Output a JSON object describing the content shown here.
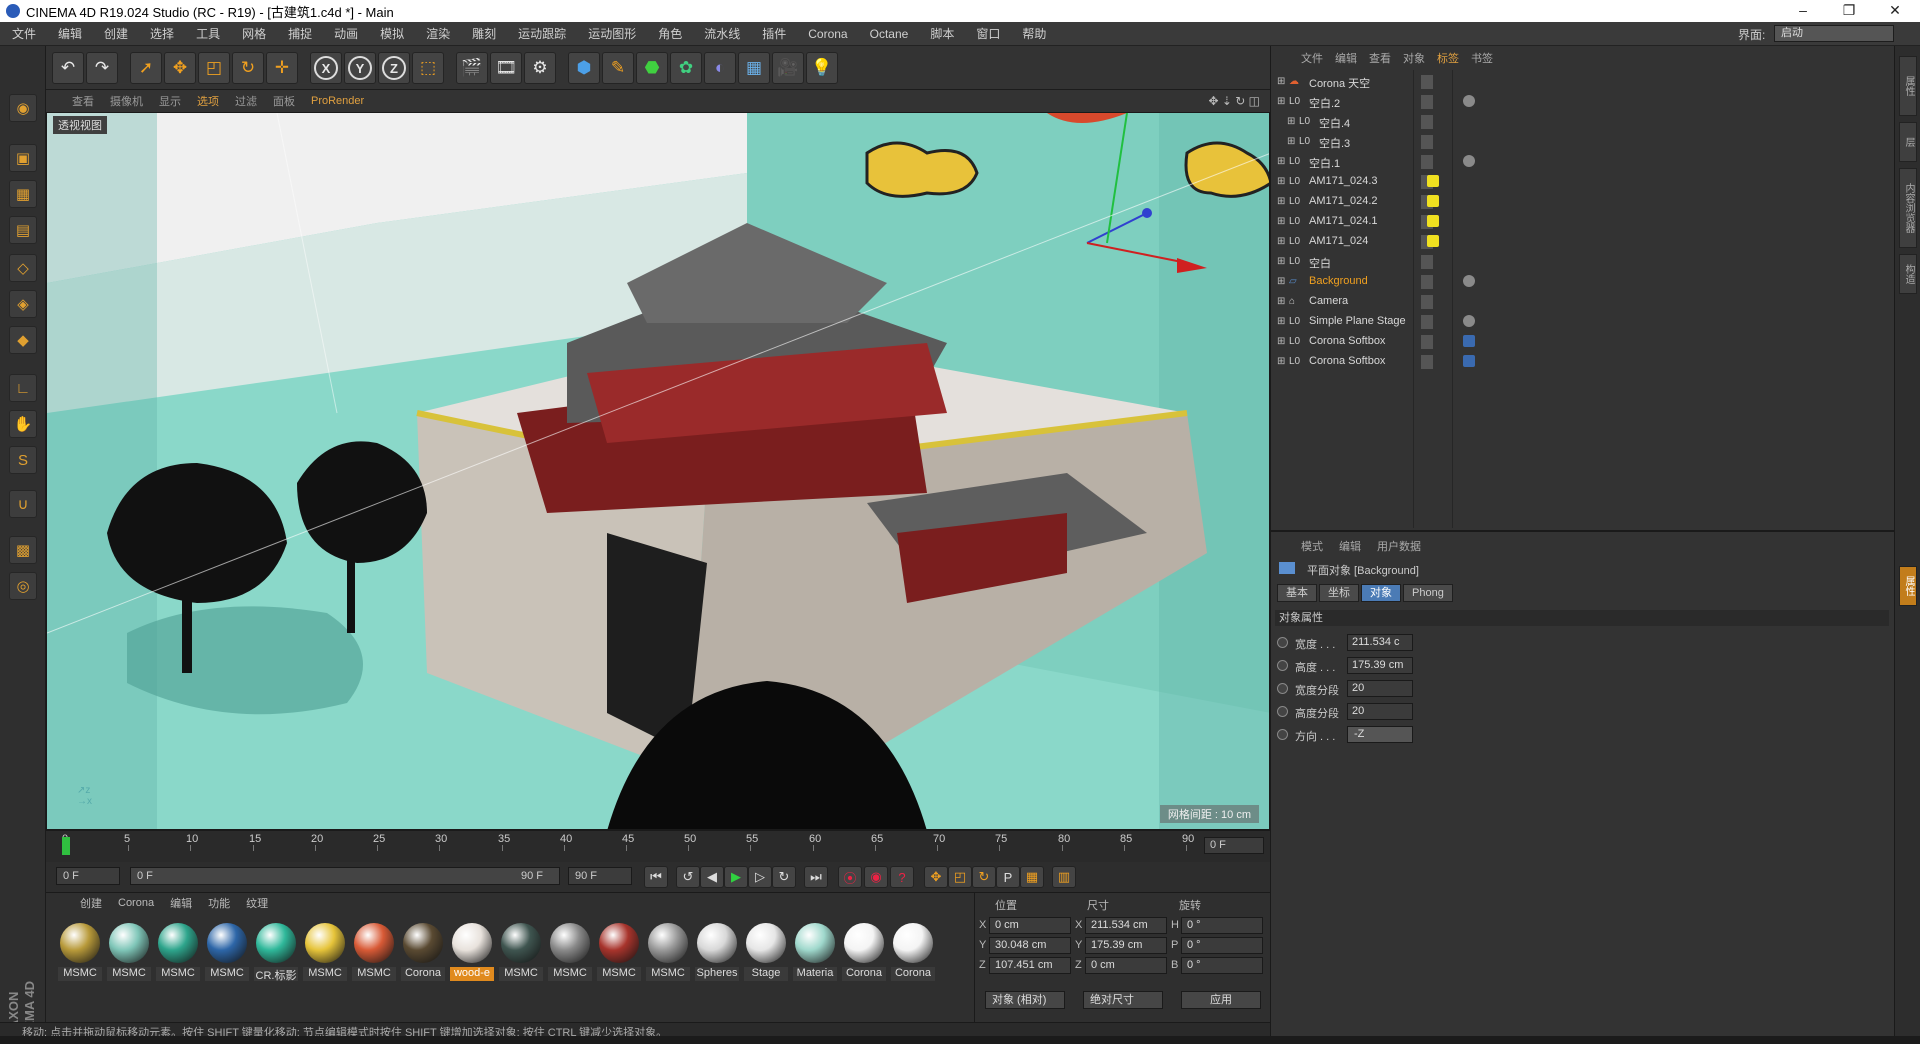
{
  "window": {
    "title": "CINEMA 4D R19.024 Studio (RC - R19) - [古建筑1.c4d *] - Main",
    "controls": [
      "–",
      "❐",
      "✕"
    ]
  },
  "menubar": {
    "items": [
      "文件",
      "编辑",
      "创建",
      "选择",
      "工具",
      "网格",
      "捕捉",
      "动画",
      "模拟",
      "渲染",
      "雕刻",
      "运动跟踪",
      "运动图形",
      "角色",
      "流水线",
      "插件",
      "Corona",
      "Octane",
      "脚本",
      "窗口",
      "帮助"
    ],
    "layout_label": "界面:",
    "layout_value": "启动"
  },
  "viewport": {
    "menu": [
      "查看",
      "摄像机",
      "显示",
      "选项",
      "过滤",
      "面板"
    ],
    "active_menu": "选项",
    "renderer": "ProRender",
    "view_label": "透视视图",
    "grid_spacing": "网格间距 : 10 cm"
  },
  "timeline": {
    "ticks": [
      "0",
      "5",
      "10",
      "15",
      "20",
      "25",
      "30",
      "35",
      "40",
      "45",
      "50",
      "55",
      "60",
      "65",
      "70",
      "75",
      "80",
      "85",
      "90"
    ],
    "current_frame": "0 F",
    "start": "0 F",
    "range_start": "0 F",
    "range_end": "90 F",
    "end": "90 F"
  },
  "materials": {
    "menu": [
      "创建",
      "Corona",
      "编辑",
      "功能",
      "纹理"
    ],
    "items": [
      {
        "name": "MSMC",
        "color": "#b89a3a"
      },
      {
        "name": "MSMC",
        "color": "#7fc6b8"
      },
      {
        "name": "MSMC",
        "color": "#2ea58c"
      },
      {
        "name": "MSMC",
        "color": "#2d66a8"
      },
      {
        "name": "CR.标影",
        "color": "#2fb89a"
      },
      {
        "name": "MSMC",
        "color": "#e6c43a"
      },
      {
        "name": "MSMC",
        "color": "#d85a36"
      },
      {
        "name": "Corona",
        "color": "#5a4a32"
      },
      {
        "name": "wood-e",
        "color": "#e8e2dc"
      },
      {
        "name": "MSMC",
        "color": "#3f5550"
      },
      {
        "name": "MSMC",
        "color": "#8a8a8a"
      },
      {
        "name": "MSMC",
        "color": "#a8342c"
      },
      {
        "name": "MSMC",
        "color": "#9a9a9a"
      },
      {
        "name": "Spheres",
        "color": "#d8d8d8"
      },
      {
        "name": "Stage",
        "color": "#e6e6e6"
      },
      {
        "name": "Materia",
        "color": "#9fd8cc"
      },
      {
        "name": "Corona",
        "color": "#f4f4f4"
      },
      {
        "name": "Corona",
        "color": "#f4f4f4"
      }
    ],
    "selected_index": 8
  },
  "coordinates": {
    "headers": [
      "位置",
      "尺寸",
      "旋转"
    ],
    "position": {
      "X": "0 cm",
      "Y": "30.048 cm",
      "Z": "107.451 cm"
    },
    "size": {
      "X": "211.534 cm",
      "Y": "175.39 cm",
      "Z": "0 cm"
    },
    "rotation": {
      "H": "0 °",
      "P": "0 °",
      "B": "0 °"
    },
    "mode_object": "对象 (相对)",
    "mode_size": "绝对尺寸",
    "apply": "应用"
  },
  "status": "移动: 点击并拖动鼠标移动元素。按住 SHIFT 键量化移动; 节点编辑模式时按住 SHIFT 键增加选择对象; 按住 CTRL 键减少选择对象。",
  "object_manager": {
    "menu": [
      "文件",
      "编辑",
      "查看",
      "对象",
      "标签",
      "书签"
    ],
    "active_menu": "标签",
    "objects": [
      {
        "name": "Corona 天空",
        "indent": 0,
        "icon": "sky-icon",
        "tag": ""
      },
      {
        "name": "空白.2",
        "indent": 0,
        "icon": "null-icon",
        "tag": "material"
      },
      {
        "name": "空白.4",
        "indent": 1,
        "icon": "null-icon",
        "tag": ""
      },
      {
        "name": "空白.3",
        "indent": 1,
        "icon": "null-icon",
        "tag": ""
      },
      {
        "name": "空白.1",
        "indent": 0,
        "icon": "null-icon",
        "tag": "material"
      },
      {
        "name": "AM171_024.3",
        "indent": 0,
        "icon": "null-icon",
        "tag": "yellow"
      },
      {
        "name": "AM171_024.2",
        "indent": 0,
        "icon": "null-icon",
        "tag": "yellow"
      },
      {
        "name": "AM171_024.1",
        "indent": 0,
        "icon": "null-icon",
        "tag": "yellow"
      },
      {
        "name": "AM171_024",
        "indent": 0,
        "icon": "null-icon",
        "tag": "yellow"
      },
      {
        "name": "空白",
        "indent": 0,
        "icon": "null-icon",
        "tag": ""
      },
      {
        "name": "Background",
        "indent": 0,
        "icon": "plane-icon",
        "tag": "material"
      },
      {
        "name": "Camera",
        "indent": 0,
        "icon": "camera-icon",
        "tag": ""
      },
      {
        "name": "Simple Plane Stage",
        "indent": 0,
        "icon": "null-icon",
        "tag": "material"
      },
      {
        "name": "Corona Softbox",
        "indent": 0,
        "icon": "null-icon",
        "tag": "target"
      },
      {
        "name": "Corona Softbox",
        "indent": 0,
        "icon": "null-icon",
        "tag": "target"
      }
    ],
    "selected_index": 10
  },
  "attributes": {
    "menu": [
      "模式",
      "编辑",
      "用户数据"
    ],
    "title": "平面对象 [Background]",
    "tabs": [
      "基本",
      "坐标",
      "对象",
      "Phong"
    ],
    "active_tab": "对象",
    "section": "对象属性",
    "fields": [
      {
        "label": "宽度 . . .",
        "value": "211.534 c"
      },
      {
        "label": "高度 . . .",
        "value": "175.39 cm"
      },
      {
        "label": "宽度分段",
        "value": "20"
      },
      {
        "label": "高度分段",
        "value": "20"
      },
      {
        "label": "方向 . . .",
        "value": "-Z",
        "dropdown": true
      }
    ]
  },
  "right_tabs": [
    "属性",
    "层",
    "内容浏览器",
    "构造"
  ]
}
